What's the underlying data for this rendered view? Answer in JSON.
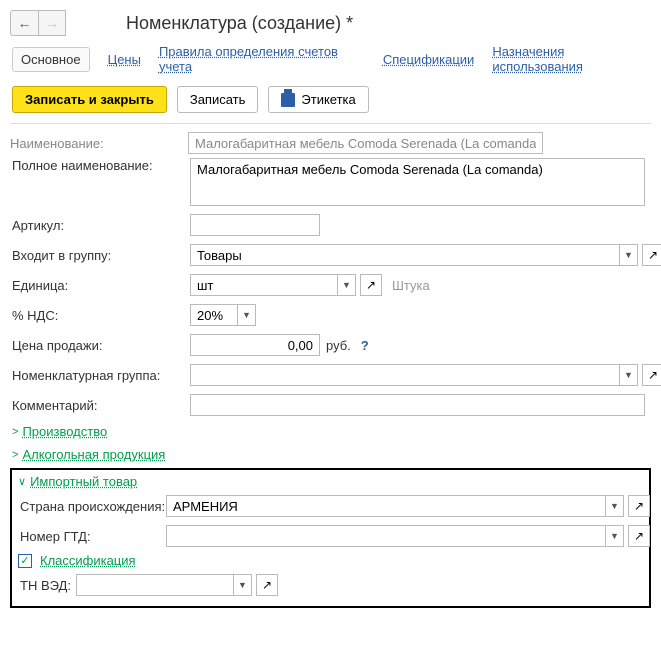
{
  "header": {
    "title": "Номенклатура (создание) *"
  },
  "tabs": {
    "main": "Основное",
    "links": [
      "Цены",
      "Правила определения счетов учета",
      "Спецификации",
      "Назначения использования"
    ]
  },
  "toolbar": {
    "save_close": "Записать и закрыть",
    "save": "Записать",
    "label": "Этикетка"
  },
  "form": {
    "name_label": "Наименование:",
    "name_value": "Малогабаритная мебель Comoda Serenada (La comanda)",
    "fullname_label": "Полное наименование:",
    "fullname_value": "Малогабаритная мебель Comoda Serenada (La comanda)",
    "article_label": "Артикул:",
    "article_value": "",
    "group_label": "Входит в группу:",
    "group_value": "Товары",
    "unit_label": "Единица:",
    "unit_value": "шт",
    "unit_suffix": "Штука",
    "vat_label": "% НДС:",
    "vat_value": "20%",
    "price_label": "Цена продажи:",
    "price_value": "0,00",
    "price_currency": "руб.",
    "nomgroup_label": "Номенклатурная группа:",
    "nomgroup_value": "",
    "comment_label": "Комментарий:",
    "comment_value": ""
  },
  "sections": {
    "production": "Производство",
    "alcohol": "Алкогольная продукция",
    "import": "Импортный товар"
  },
  "import_block": {
    "country_label": "Страна происхождения:",
    "country_value": "АРМЕНИЯ",
    "gtd_label": "Номер ГТД:",
    "gtd_value": "",
    "classification": "Классификация",
    "tnved_label": "ТН ВЭД:",
    "tnved_value": ""
  }
}
